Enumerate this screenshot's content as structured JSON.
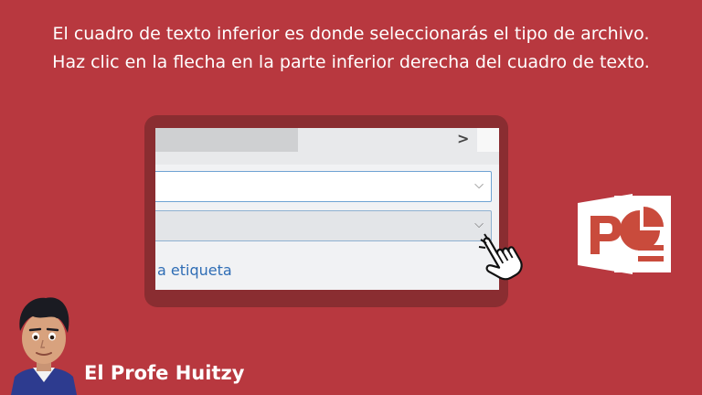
{
  "caption": {
    "line1": "El cuadro de texto inferior es donde seleccionarás el tipo de archivo.",
    "line2": "Haz clic en la flecha en la parte inferior derecha del cuadro de texto."
  },
  "dialog": {
    "breadcrumb_arrow": ">",
    "combo_chevron": "⌵",
    "link_text": "a etiqueta"
  },
  "brand": {
    "name": "El Profe Huitzy"
  },
  "icons": [
    "hand-pointer-icon",
    "powerpoint-icon",
    "chevron-down-icon",
    "chevron-right-icon"
  ],
  "colors": {
    "background": "#b8383f",
    "frame": "#8a2d31",
    "link": "#2f6db5",
    "powerpoint_red": "#c94b3c"
  }
}
